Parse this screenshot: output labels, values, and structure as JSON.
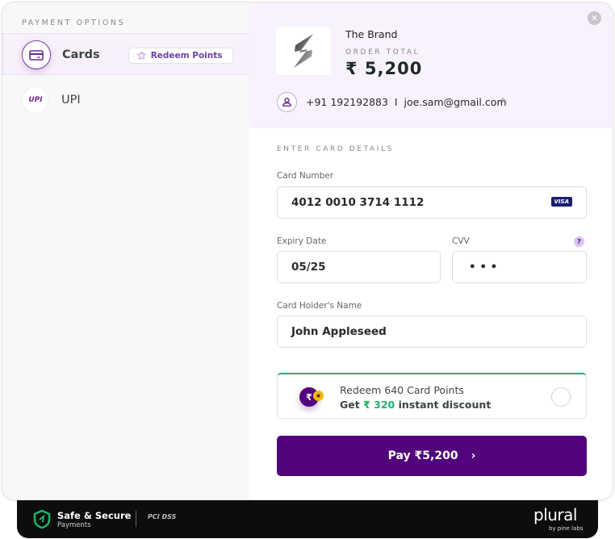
{
  "sidebar": {
    "title": "PAYMENT OPTIONS",
    "items": [
      {
        "label": "Cards",
        "icon": "credit-card-icon",
        "selected": true,
        "badge": "Redeem Points"
      },
      {
        "label": "UPI",
        "icon": "upi-logo-icon",
        "selected": false,
        "logo_text": "UPI"
      }
    ]
  },
  "merchant": {
    "name": "The Brand",
    "order_total_label": "ORDER TOTAL",
    "order_total": "₹ 5,200",
    "contact": "+91 192192883  I  joe.sam@gmail.com"
  },
  "form": {
    "section_title": "ENTER CARD DETAILS",
    "card_number_label": "Card Number",
    "card_number": "4012 0010 3714 1112",
    "card_brand": "VISA",
    "expiry_label": "Expiry Date",
    "expiry": "05/25",
    "cvv_label": "CVV",
    "cvv": "• • •",
    "holder_label": "Card Holder's Name",
    "holder": "John Appleseed"
  },
  "redeem": {
    "title": "Redeem 640 Card Points",
    "prefix": "Get ",
    "amount": "₹ 320",
    "suffix": " instant discount",
    "checked": false
  },
  "pay_button": "Pay ₹5,200",
  "footer": {
    "secure_title": "Safe & Secure",
    "secure_sub": "Payments",
    "pci": "PCI DSS",
    "brand": "plural",
    "brand_sub": "by pine labs"
  },
  "colors": {
    "accent": "#52057b",
    "green": "#1db46a",
    "header_bg": "#f7f2fd"
  }
}
